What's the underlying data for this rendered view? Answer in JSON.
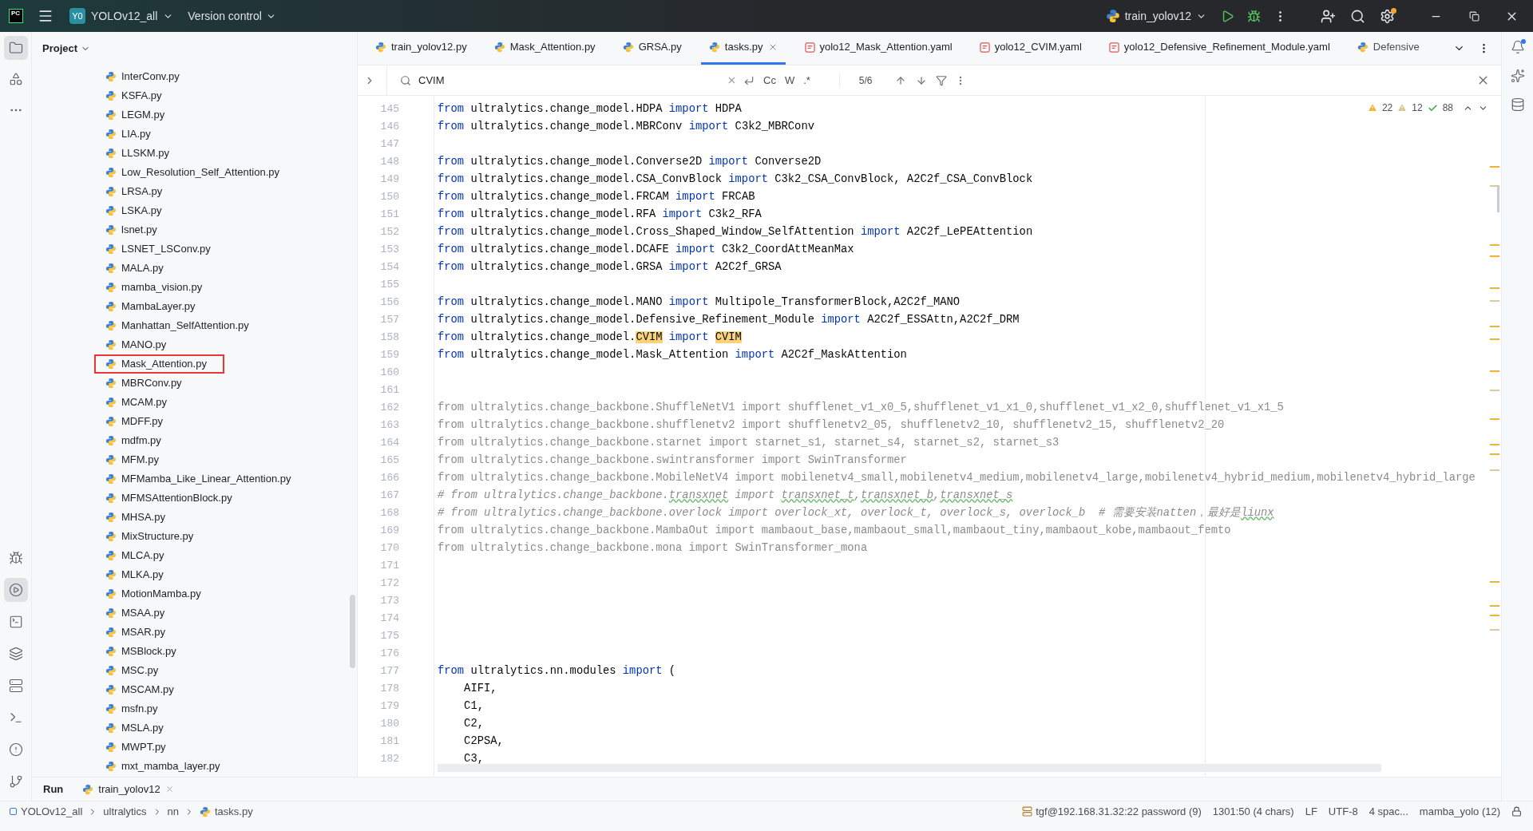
{
  "titlebar": {
    "logo": "PC",
    "project": {
      "badge": "Y0",
      "name": "YOLOv12_all"
    },
    "vcs": "Version control",
    "run_config": "train_yolov12"
  },
  "left_toolbar": {
    "top": [
      {
        "kind": "project",
        "selected": true
      },
      {
        "kind": "structure",
        "selected": false
      },
      {
        "kind": "more",
        "selected": false
      }
    ],
    "bottom": [
      {
        "kind": "debug",
        "selected": false
      },
      {
        "kind": "run",
        "selected": true
      },
      {
        "kind": "console",
        "selected": false
      },
      {
        "kind": "packages",
        "selected": false
      },
      {
        "kind": "services",
        "selected": false
      },
      {
        "kind": "terminal",
        "selected": false
      },
      {
        "kind": "problems",
        "selected": false
      },
      {
        "kind": "git",
        "selected": false
      }
    ]
  },
  "project_panel": {
    "title": "Project",
    "items": [
      {
        "name": "InterConv.py",
        "marked": false
      },
      {
        "name": "KSFA.py",
        "marked": false
      },
      {
        "name": "LEGM.py",
        "marked": false
      },
      {
        "name": "LIA.py",
        "marked": false
      },
      {
        "name": "LLSKM.py",
        "marked": false
      },
      {
        "name": "Low_Resolution_Self_Attention.py",
        "marked": false
      },
      {
        "name": "LRSA.py",
        "marked": false
      },
      {
        "name": "LSKA.py",
        "marked": false
      },
      {
        "name": "lsnet.py",
        "marked": false
      },
      {
        "name": "LSNET_LSConv.py",
        "marked": false
      },
      {
        "name": "MALA.py",
        "marked": false
      },
      {
        "name": "mamba_vision.py",
        "marked": false
      },
      {
        "name": "MambaLayer.py",
        "marked": false
      },
      {
        "name": "Manhattan_SelfAttention.py",
        "marked": false
      },
      {
        "name": "MANO.py",
        "marked": false
      },
      {
        "name": "Mask_Attention.py",
        "marked": true
      },
      {
        "name": "MBRConv.py",
        "marked": false
      },
      {
        "name": "MCAM.py",
        "marked": false
      },
      {
        "name": "MDFF.py",
        "marked": false
      },
      {
        "name": "mdfm.py",
        "marked": false
      },
      {
        "name": "MFM.py",
        "marked": false
      },
      {
        "name": "MFMamba_Like_Linear_Attention.py",
        "marked": false
      },
      {
        "name": "MFMSAttentionBlock.py",
        "marked": false
      },
      {
        "name": "MHSA.py",
        "marked": false
      },
      {
        "name": "MixStructure.py",
        "marked": false
      },
      {
        "name": "MLCA.py",
        "marked": false
      },
      {
        "name": "MLKA.py",
        "marked": false
      },
      {
        "name": "MotionMamba.py",
        "marked": false
      },
      {
        "name": "MSAA.py",
        "marked": false
      },
      {
        "name": "MSAR.py",
        "marked": false
      },
      {
        "name": "MSBlock.py",
        "marked": false
      },
      {
        "name": "MSC.py",
        "marked": false
      },
      {
        "name": "MSCAM.py",
        "marked": false
      },
      {
        "name": "msfn.py",
        "marked": false
      },
      {
        "name": "MSLA.py",
        "marked": false
      },
      {
        "name": "MWPT.py",
        "marked": false
      },
      {
        "name": "mxt_mamba_layer.py",
        "marked": false
      }
    ]
  },
  "tabs": [
    {
      "label": "train_yolov12.py",
      "kind": "python",
      "selected": false
    },
    {
      "label": "Mask_Attention.py",
      "kind": "python",
      "selected": false
    },
    {
      "label": "GRSA.py",
      "kind": "python",
      "selected": false
    },
    {
      "label": "tasks.py",
      "kind": "python",
      "selected": true
    },
    {
      "label": "yolo12_Mask_Attention.yaml",
      "kind": "yaml",
      "selected": false
    },
    {
      "label": "yolo12_CVIM.yaml",
      "kind": "yaml",
      "selected": false
    },
    {
      "label": "yolo12_Defensive_Refinement_Module.yaml",
      "kind": "yaml",
      "selected": false
    },
    {
      "label": "Defensive",
      "kind": "python",
      "selected": false
    }
  ],
  "find": {
    "value": "CVIM",
    "options": [
      "Cc",
      "W",
      ".*"
    ],
    "count": "5/6"
  },
  "inspections": {
    "warnings": "22",
    "weak_warnings": "12",
    "typos": "88"
  },
  "code": [
    {
      "number": "145",
      "segments": [
        {
          "kind": "kw",
          "text": "from"
        },
        {
          "kind": "plain",
          "text": " ultralytics.change_model.HDPA "
        },
        {
          "kind": "kw",
          "text": "import"
        },
        {
          "kind": "plain",
          "text": " HDPA"
        }
      ]
    },
    {
      "number": "146",
      "segments": [
        {
          "kind": "kw",
          "text": "from"
        },
        {
          "kind": "plain",
          "text": " ultralytics.change_model.MBRConv "
        },
        {
          "kind": "kw",
          "text": "import"
        },
        {
          "kind": "plain",
          "text": " C3k2_MBRConv"
        }
      ]
    },
    {
      "number": "147"
    },
    {
      "number": "148",
      "segments": [
        {
          "kind": "kw",
          "text": "from"
        },
        {
          "kind": "plain",
          "text": " ultralytics.change_model.Converse2D "
        },
        {
          "kind": "kw",
          "text": "import"
        },
        {
          "kind": "plain",
          "text": " Converse2D"
        }
      ]
    },
    {
      "number": "149",
      "segments": [
        {
          "kind": "kw",
          "text": "from"
        },
        {
          "kind": "plain",
          "text": " ultralytics.change_model.CSA_ConvBlock "
        },
        {
          "kind": "kw",
          "text": "import"
        },
        {
          "kind": "plain",
          "text": " C3k2_CSA_ConvBlock, A2C2f_CSA_ConvBlock"
        }
      ]
    },
    {
      "number": "150",
      "segments": [
        {
          "kind": "kw",
          "text": "from"
        },
        {
          "kind": "plain",
          "text": " ultralytics.change_model.FRCAM "
        },
        {
          "kind": "kw",
          "text": "import"
        },
        {
          "kind": "plain",
          "text": " FRCAB"
        }
      ]
    },
    {
      "number": "151",
      "segments": [
        {
          "kind": "kw",
          "text": "from"
        },
        {
          "kind": "plain",
          "text": " ultralytics.change_model.RFA "
        },
        {
          "kind": "kw",
          "text": "import"
        },
        {
          "kind": "plain",
          "text": " C3k2_RFA"
        }
      ]
    },
    {
      "number": "152",
      "segments": [
        {
          "kind": "kw",
          "text": "from"
        },
        {
          "kind": "plain",
          "text": " ultralytics.change_model.Cross_Shaped_Window_SelfAttention "
        },
        {
          "kind": "kw",
          "text": "import"
        },
        {
          "kind": "plain",
          "text": " A2C2f_LePEAttention"
        }
      ]
    },
    {
      "number": "153",
      "segments": [
        {
          "kind": "kw",
          "text": "from"
        },
        {
          "kind": "plain",
          "text": " ultralytics.change_model.DCAFE "
        },
        {
          "kind": "kw",
          "text": "import"
        },
        {
          "kind": "plain",
          "text": " C3k2_CoordAttMeanMax"
        }
      ]
    },
    {
      "number": "154",
      "segments": [
        {
          "kind": "kw",
          "text": "from"
        },
        {
          "kind": "plain",
          "text": " ultralytics.change_model.GRSA "
        },
        {
          "kind": "kw",
          "text": "import"
        },
        {
          "kind": "plain",
          "text": " A2C2f_GRSA"
        }
      ]
    },
    {
      "number": "155"
    },
    {
      "number": "156",
      "segments": [
        {
          "kind": "kw",
          "text": "from"
        },
        {
          "kind": "plain",
          "text": " ultralytics.change_model.MANO "
        },
        {
          "kind": "kw",
          "text": "import"
        },
        {
          "kind": "plain",
          "text": " Multipole_TransformerBlock,A2C2f_MANO"
        }
      ]
    },
    {
      "number": "157",
      "segments": [
        {
          "kind": "kw",
          "text": "from"
        },
        {
          "kind": "plain",
          "text": " ultralytics.change_model.Defensive_Refinement_Module "
        },
        {
          "kind": "kw",
          "text": "import"
        },
        {
          "kind": "plain",
          "text": " A2C2f_ESSAttn,A2C2f_DRM"
        }
      ]
    },
    {
      "number": "158",
      "segments": [
        {
          "kind": "kw",
          "text": "from"
        },
        {
          "kind": "plain",
          "text": " ultralytics.change_model."
        },
        {
          "kind": "match",
          "text": "CVIM"
        },
        {
          "kind": "kw",
          "text": " import "
        },
        {
          "kind": "match",
          "text": "CVIM"
        }
      ]
    },
    {
      "number": "159",
      "segments": [
        {
          "kind": "kw",
          "text": "from"
        },
        {
          "kind": "plain",
          "text": " ultralytics.change_model.Mask_Attention "
        },
        {
          "kind": "kw",
          "text": "import"
        },
        {
          "kind": "plain",
          "text": " A2C2f_MaskAttention"
        }
      ]
    },
    {
      "number": "160"
    },
    {
      "number": "161"
    },
    {
      "number": "162",
      "segments": [
        {
          "kind": "dim",
          "text": "from ultralytics.change_backbone.ShuffleNetV1 import shufflenet_v1_x0_5,shufflenet_v1_x1_0,shufflenet_v1_x2_0,shufflenet_v1_x1_5"
        }
      ]
    },
    {
      "number": "163",
      "segments": [
        {
          "kind": "dim",
          "text": "from ultralytics.change_backbone.shufflenetv2 import shufflenetv2_05, shufflenetv2_10, shufflenetv2_15, shufflenetv2_20"
        }
      ]
    },
    {
      "number": "164",
      "segments": [
        {
          "kind": "dim",
          "text": "from ultralytics.change_backbone.starnet import starnet_s1, starnet_s4, starnet_s2, starnet_s3"
        }
      ]
    },
    {
      "number": "165",
      "segments": [
        {
          "kind": "dim",
          "text": "from ultralytics.change_backbone.swintransformer import SwinTransformer"
        }
      ]
    },
    {
      "number": "166",
      "segments": [
        {
          "kind": "dim",
          "text": "from ultralytics.change_backbone.MobileNetV4 import mobilenetv4_small,mobilenetv4_medium,mobilenetv4_large,mobilenetv4_hybrid_medium,mobilenetv4_hybrid_large"
        }
      ]
    },
    {
      "number": "167",
      "segments": [
        {
          "kind": "comment",
          "text": "# from ultralytics.change_backbone."
        },
        {
          "kind": "typo",
          "text": "transxnet"
        },
        {
          "kind": "comment",
          "text": " import "
        },
        {
          "kind": "typo",
          "text": "transxnet_t"
        },
        {
          "kind": "comment",
          "text": ","
        },
        {
          "kind": "typo",
          "text": "transxnet_b"
        },
        {
          "kind": "comment",
          "text": ","
        },
        {
          "kind": "typo",
          "text": "transxnet_s"
        }
      ]
    },
    {
      "number": "168",
      "segments": [
        {
          "kind": "comment",
          "text": "# from ultralytics.change_backbone.overlock import overlock_xt, overlock_t, overlock_s, overlock_b  # 需要安装natten，最好是"
        },
        {
          "kind": "typo",
          "text": "liunx"
        }
      ]
    },
    {
      "number": "169",
      "segments": [
        {
          "kind": "dim",
          "text": "from ultralytics.change_backbone.MambaOut import mambaout_base,mambaout_small,mambaout_tiny,mambaout_kobe,mambaout_femto"
        }
      ]
    },
    {
      "number": "170",
      "segments": [
        {
          "kind": "dim",
          "text": "from ultralytics.change_backbone.mona import SwinTransformer_mona"
        }
      ]
    },
    {
      "number": "171"
    },
    {
      "number": "172"
    },
    {
      "number": "173"
    },
    {
      "number": "174"
    },
    {
      "number": "175"
    },
    {
      "number": "176"
    },
    {
      "number": "177",
      "segments": [
        {
          "kind": "kw",
          "text": "from"
        },
        {
          "kind": "plain",
          "text": " ultralytics.nn.modules "
        },
        {
          "kind": "kw",
          "text": "import"
        },
        {
          "kind": "plain",
          "text": " ("
        }
      ]
    },
    {
      "number": "178",
      "segments": [
        {
          "kind": "plain",
          "text": "    AIFI,"
        }
      ]
    },
    {
      "number": "179",
      "segments": [
        {
          "kind": "plain",
          "text": "    C1,"
        }
      ]
    },
    {
      "number": "180",
      "segments": [
        {
          "kind": "plain",
          "text": "    C2,"
        }
      ]
    },
    {
      "number": "181",
      "segments": [
        {
          "kind": "plain",
          "text": "    C2PSA,"
        }
      ]
    },
    {
      "number": "182",
      "segments": [
        {
          "kind": "plain",
          "text": "    C3,"
        }
      ]
    }
  ],
  "run_panel": {
    "title": "Run",
    "tab": "train_yolov12"
  },
  "status_bar": {
    "breadcrumbs": [
      {
        "kind": "module",
        "text": "YOLOv12_all"
      },
      {
        "kind": "folder",
        "text": "ultralytics"
      },
      {
        "kind": "folder",
        "text": "nn"
      },
      {
        "kind": "python",
        "text": "tasks.py"
      }
    ],
    "items": [
      {
        "kind": "remote",
        "text": "tgf@192.168.31.32:22 password (9)"
      },
      {
        "kind": "text",
        "text": "1301:50 (4 chars)"
      },
      {
        "kind": "text",
        "text": "LF"
      },
      {
        "kind": "text",
        "text": "UTF-8"
      },
      {
        "kind": "text",
        "text": "4 spac..."
      },
      {
        "kind": "text",
        "text": "mamba_yolo (12)"
      }
    ]
  }
}
